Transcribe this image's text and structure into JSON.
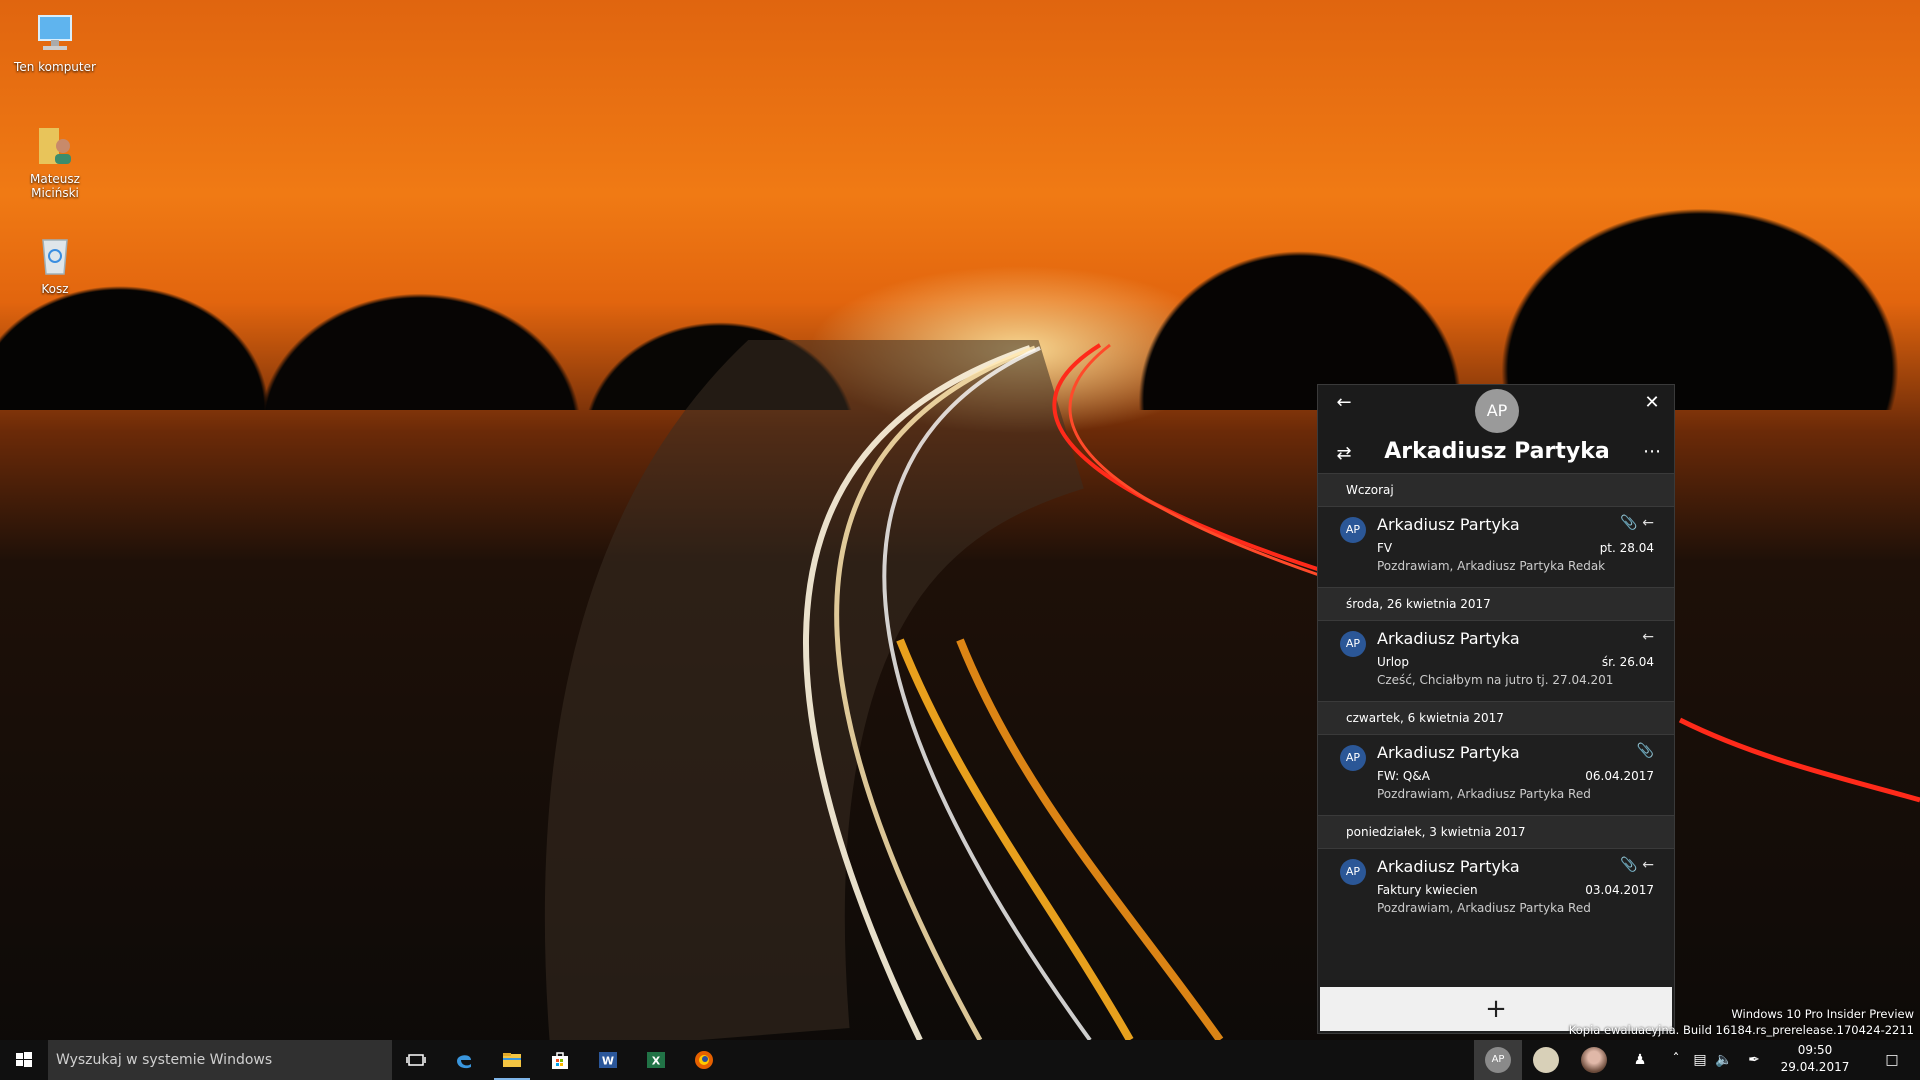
{
  "desktop": {
    "icons": [
      {
        "label": "Ten komputer"
      },
      {
        "label": "Mateusz Miciński"
      },
      {
        "label": "Kosz"
      }
    ]
  },
  "people_window": {
    "avatar_initials": "AP",
    "contact_name": "Arkadiusz Partyka",
    "groups": [
      {
        "header": "Wczoraj",
        "item": {
          "initials": "AP",
          "sender": "Arkadiusz Partyka",
          "subject": "FV",
          "date": "pt. 28.04",
          "preview": "Pozdrawiam,  Arkadiusz Partyka   Redak",
          "icons": "attachment-reply"
        }
      },
      {
        "header": "środa, 26 kwietnia 2017",
        "item": {
          "initials": "AP",
          "sender": "Arkadiusz Partyka",
          "subject": "Urlop",
          "date": "śr. 26.04",
          "preview": "Cześć,     Chciałbym na jutro tj. 27.04.201",
          "icons": "reply"
        }
      },
      {
        "header": "czwartek, 6 kwietnia 2017",
        "item": {
          "initials": "AP",
          "sender": "Arkadiusz Partyka",
          "subject": "FW: Q&A",
          "date": "06.04.2017",
          "preview": "Pozdrawiam,  Arkadiusz Partyka   Red",
          "icons": "attachment"
        }
      },
      {
        "header": "poniedziałek, 3 kwietnia 2017",
        "item": {
          "initials": "AP",
          "sender": "Arkadiusz Partyka",
          "subject": "Faktury kwiecien",
          "date": "03.04.2017",
          "preview": "Pozdrawiam,  Arkadiusz Partyka   Red",
          "icons": "attachment-reply"
        }
      }
    ],
    "add_button_icon": "plus-icon"
  },
  "watermark": {
    "line1": "Windows 10 Pro Insider Preview",
    "line2": "Kopia ewaluacyjna. Build 16184.rs_prerelease.170424-2211"
  },
  "taskbar": {
    "search_placeholder": "Wyszukaj w systemie Windows",
    "pinned_people_initials": "AP",
    "clock_time": "09:50",
    "clock_date": "29.04.2017"
  },
  "colors": {
    "avatar_blue": "#2b5797",
    "window_bg": "#1f1f1f",
    "taskbar_bg": "#101010"
  }
}
